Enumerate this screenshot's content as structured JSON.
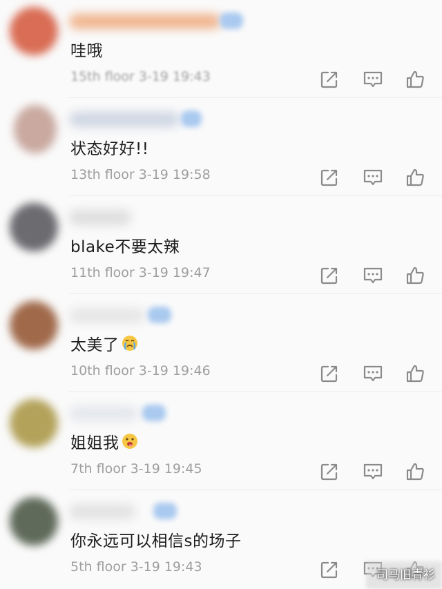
{
  "comments": [
    {
      "content": "哇哦",
      "emoji": "",
      "meta": "15th floor 3-19 19:43",
      "avatar_color": "#d96d55",
      "username_color": "#f0b58f",
      "badge": true
    },
    {
      "content": "状态好好!!",
      "emoji": "",
      "meta": "13th floor 3-19 19:58",
      "avatar_color": "#c9a9a0",
      "username_color": "#cfd6e3",
      "badge": true
    },
    {
      "content": "blake不要太辣",
      "emoji": "",
      "meta": "11th floor 3-19 19:47",
      "avatar_color": "#6b6b70",
      "username_color": "#dedede",
      "badge": false
    },
    {
      "content": "太美了",
      "emoji": "crying-face-emoji",
      "meta": "10th floor 3-19 19:46",
      "avatar_color": "#a0694a",
      "username_color": "#e6e6e6",
      "badge": true
    },
    {
      "content": "姐姐我",
      "emoji": "drooling-face-emoji",
      "meta": "7th floor 3-19 19:45",
      "avatar_color": "#b3a25a",
      "username_color": "#e4e7ec",
      "badge": true
    },
    {
      "content": "你永远可以相信s的场子",
      "emoji": "",
      "meta": "5th floor 3-19 19:43",
      "avatar_color": "#5f6a5a",
      "username_color": "#e2e2e2",
      "badge": true
    }
  ],
  "actions": {
    "share_icon": "share-icon",
    "comment_icon": "comment-icon",
    "like_icon": "thumbs-up-icon"
  },
  "colors": {
    "icon": "#8a8a8a",
    "text": "#1c1c1c",
    "meta": "#9e9e9e"
  },
  "watermark": "司马旧青衫"
}
